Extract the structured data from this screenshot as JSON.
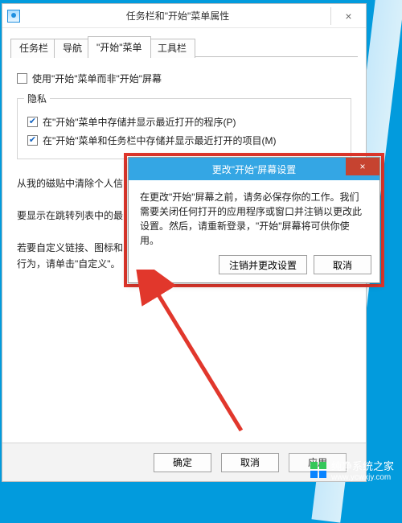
{
  "window": {
    "title": "任务栏和\"开始\"菜单属性",
    "close_glyph": "×",
    "tabs": [
      {
        "label": "任务栏"
      },
      {
        "label": "导航"
      },
      {
        "label": "\"开始\"菜单"
      },
      {
        "label": "工具栏"
      }
    ],
    "use_start_menu_checkbox": "使用\"开始\"菜单而非\"开始\"屏幕",
    "privacy_group_title": "隐私",
    "privacy_check1": "在\"开始\"菜单中存储并显示最近打开的程序(P)",
    "privacy_check2": "在\"开始\"菜单和任务栏中存储并显示最近打开的项目(M)",
    "para1": "从我的磁贴中清除个人信",
    "para2": "要显示在跳转列表中的最",
    "para3a": "若要自定义链接、图标和",
    "para3b": "行为，请单击\"自定义\"。",
    "ok": "确定",
    "cancel": "取消",
    "apply": "应用"
  },
  "dialog": {
    "title": "更改\"开始\"屏幕设置",
    "close_glyph": "×",
    "body": "在更改\"开始\"屏幕之前，请务必保存你的工作。我们需要关闭任何打开的应用程序或窗口并注销以更改此设置。然后，请重新登录，\"开始\"屏幕将可供你使用。",
    "btn_primary": "注销并更改设置",
    "btn_cancel": "取消"
  },
  "watermark": {
    "brand": "纯净系统之家",
    "url": "www.ycwxjy.com"
  }
}
